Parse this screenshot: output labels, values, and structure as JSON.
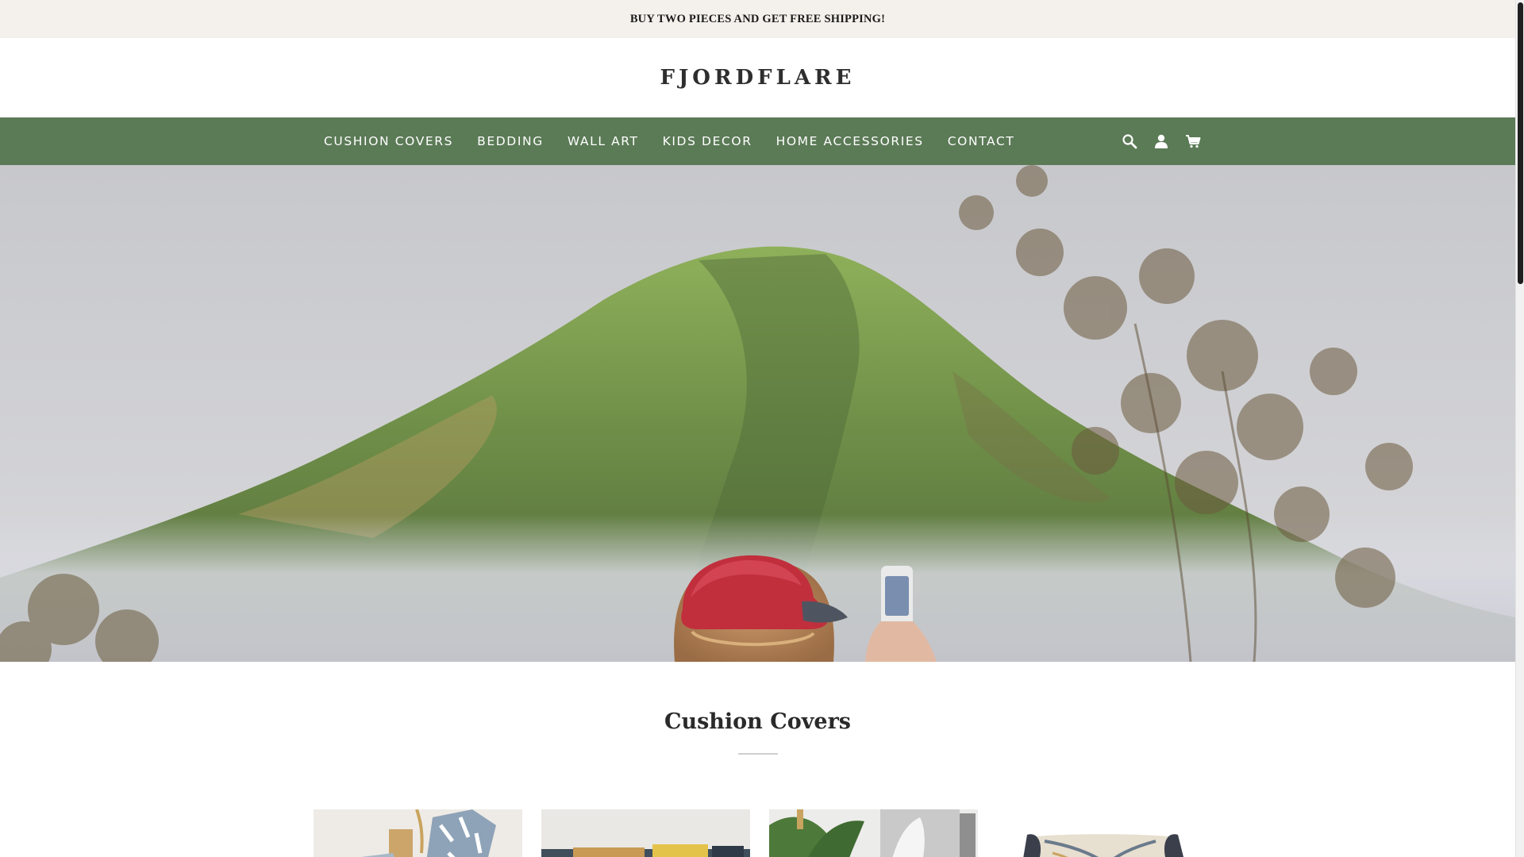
{
  "announcement": {
    "text": "BUY TWO PIECES AND GET FREE SHIPPING!"
  },
  "header": {
    "logo": "FJORDFLARE"
  },
  "nav": {
    "items": [
      {
        "label": "CUSHION COVERS"
      },
      {
        "label": "BEDDING"
      },
      {
        "label": "WALL ART"
      },
      {
        "label": "KIDS DECOR"
      },
      {
        "label": "HOME ACCESSORIES"
      },
      {
        "label": "CONTACT"
      }
    ],
    "icons": [
      "search-icon",
      "account-icon",
      "cart-icon"
    ]
  },
  "hero": {
    "image": "person-with-red-cap-photographing-green-mountain"
  },
  "collection": {
    "title": "Cushion Covers",
    "products": [
      {
        "image": "blue-zebra-cushions-with-gold-leaf"
      },
      {
        "image": "bed-with-yellow-cushions"
      },
      {
        "image": "plant-with-marble-art-cushion"
      },
      {
        "image": "dark-patterned-cushion"
      }
    ]
  },
  "colors": {
    "announcement_bg": "#f4f1ec",
    "nav_bg": "#5b7a56",
    "nav_text": "#ffffff",
    "logo_text": "#2e2e2e"
  }
}
